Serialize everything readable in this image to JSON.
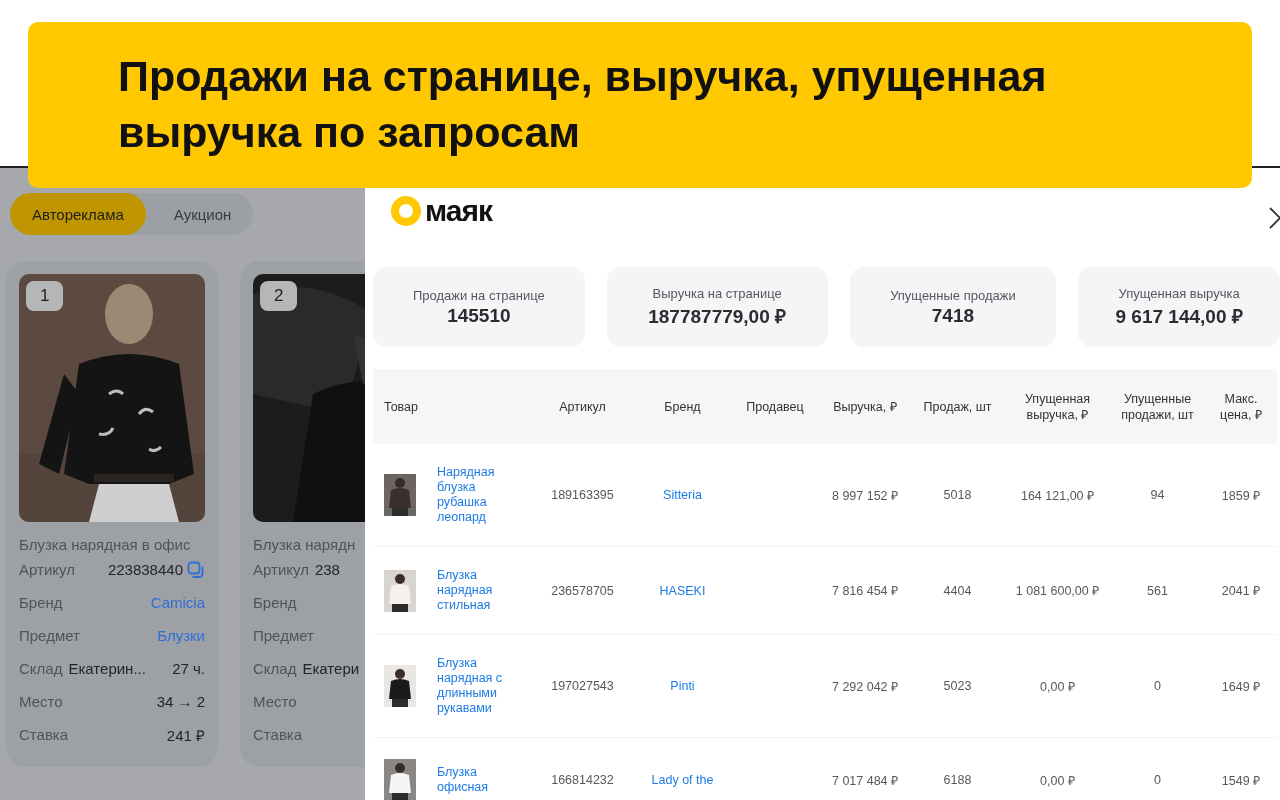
{
  "banner": {
    "title": "Продажи на странице, выручка, упущенная выручка по запросам"
  },
  "tabs": [
    {
      "label": "Автореклама",
      "selected": true
    },
    {
      "label": "Аукцион",
      "selected": false
    }
  ],
  "cards": [
    {
      "number": "1",
      "title": "Блузка нарядная в офис",
      "fields": [
        {
          "kind": "copy",
          "label": "Артикул",
          "value": "223838440"
        },
        {
          "kind": "link",
          "label": "Бренд",
          "value": "Camicia"
        },
        {
          "kind": "link",
          "label": "Предмет",
          "value": "Блузки"
        },
        {
          "kind": "split",
          "label": "Склад",
          "value": "Екатерин...",
          "extra": "27 ч."
        },
        {
          "kind": "text",
          "label": "Место",
          "value": "34 → 2"
        },
        {
          "kind": "text",
          "label": "Ставка",
          "value": "241 ₽"
        }
      ]
    },
    {
      "number": "2",
      "title": "Блузка нарядн",
      "fields": [
        {
          "kind": "inline",
          "label": "Артикул",
          "value": "238"
        },
        {
          "kind": "text",
          "label": "Бренд"
        },
        {
          "kind": "text",
          "label": "Предмет"
        },
        {
          "kind": "inline",
          "label": "Склад",
          "value": "Екатери"
        },
        {
          "kind": "text",
          "label": "Место"
        },
        {
          "kind": "text",
          "label": "Ставка"
        }
      ]
    }
  ],
  "panel": {
    "logo": "маяк",
    "stats": [
      {
        "label": "Продажи на странице",
        "value": "145510"
      },
      {
        "label": "Выручка на странице",
        "value": "187787779,00 ₽"
      },
      {
        "label": "Упущенные продажи",
        "value": "7418"
      },
      {
        "label": "Упущенная выручка",
        "value": "9 617 144,00 ₽"
      }
    ],
    "table": {
      "columns": [
        "Товар",
        "Артикул",
        "Бренд",
        "Продавец",
        "Выручка, ₽",
        "Продаж, шт",
        "Упущенная выручка, ₽",
        "Упущенные продажи, шт",
        "Макс. цена, ₽"
      ],
      "rows": [
        {
          "name": "Нарядная блузка рубашка леопард",
          "article": "189163395",
          "brand": "Sitteria",
          "revenue": "8 997 152 ₽",
          "sales": "5018",
          "lost_revenue": "164 121,00 ₽",
          "lost_sales": "94",
          "max_price": "1859 ₽"
        },
        {
          "name": "Блузка нарядная стильная",
          "article": "236578705",
          "brand": "HASEKI",
          "revenue": "7 816 454 ₽",
          "sales": "4404",
          "lost_revenue": "1 081 600,00 ₽",
          "lost_sales": "561",
          "max_price": "2041 ₽"
        },
        {
          "name": "Блузка нарядная с длинными рукавами",
          "article": "197027543",
          "brand": "Pinti",
          "revenue": "7 292 042 ₽",
          "sales": "5023",
          "lost_revenue": "0,00 ₽",
          "lost_sales": "0",
          "max_price": "1649 ₽"
        },
        {
          "name": "Блузка офисная",
          "article": "166814232",
          "brand": "Lady of the",
          "revenue": "7 017 484 ₽",
          "sales": "6188",
          "lost_revenue": "0,00 ₽",
          "lost_sales": "0",
          "max_price": "1549 ₽"
        }
      ]
    }
  }
}
